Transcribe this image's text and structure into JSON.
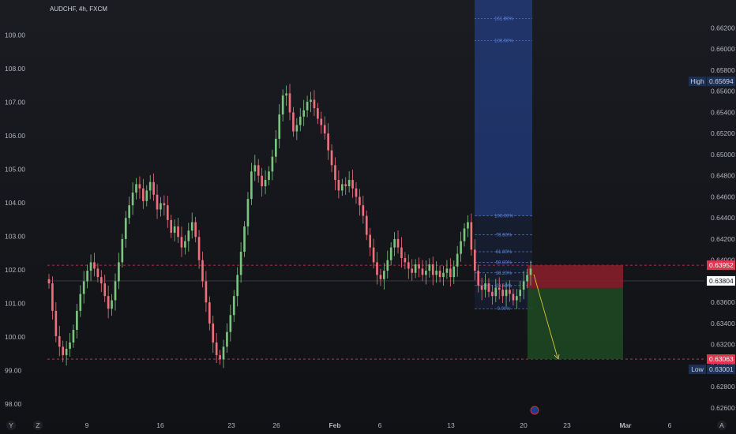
{
  "header": {
    "symbol": "AUDCHF, 4h, FXCM"
  },
  "colors": {
    "background": "#101114",
    "up_candle": "#7bc47f",
    "down_candle": "#ef6f7c",
    "fib_blue": "#2c5fe0",
    "resistance_line": "#e0344f",
    "stop_zone": "#8c1f2b",
    "target_zone": "#1f4a23",
    "arrow": "#d8c53a",
    "high_tag": "#1c2f55",
    "low_tag": "#1c2f55",
    "price_tag_red": "#e0344f"
  },
  "chart_data": {
    "type": "candlestick",
    "title": "AUDCHF, 4h, FXCM",
    "left_axis": {
      "ticks": [
        "109.00",
        "108.00",
        "107.00",
        "106.00",
        "105.00",
        "104.00",
        "103.00",
        "102.00",
        "101.00",
        "100.00",
        "99.00",
        "98.00"
      ],
      "ylim": [
        97.7,
        109.9
      ]
    },
    "right_axis": {
      "ticks": [
        "0.66200",
        "0.66000",
        "0.65800",
        "0.65600",
        "0.65400",
        "0.65200",
        "0.65000",
        "0.64800",
        "0.64600",
        "0.64400",
        "0.64200",
        "0.64000",
        "0.63800",
        "0.63600",
        "0.63400",
        "0.63200",
        "0.63000",
        "0.62800",
        "0.62600"
      ],
      "ylim": [
        0.6254,
        0.6642
      ]
    },
    "x_ticks": [
      "9",
      "16",
      "23",
      "26",
      "Feb",
      "6",
      "13",
      "20",
      "23",
      "Mar",
      "6"
    ],
    "bottom_left_labels": [
      "Y",
      "Z"
    ],
    "bottom_right_label": "A",
    "close_series": [
      0.6378,
      0.6352,
      0.6328,
      0.6318,
      0.631,
      0.6316,
      0.6322,
      0.6334,
      0.6352,
      0.6368,
      0.638,
      0.639,
      0.6398,
      0.6392,
      0.6384,
      0.6378,
      0.6366,
      0.6354,
      0.6362,
      0.638,
      0.6398,
      0.642,
      0.644,
      0.6452,
      0.6464,
      0.6472,
      0.6468,
      0.6456,
      0.6466,
      0.6474,
      0.6462,
      0.6448,
      0.6454,
      0.6452,
      0.6438,
      0.6426,
      0.6432,
      0.6422,
      0.6412,
      0.6418,
      0.6428,
      0.6436,
      0.6422,
      0.64,
      0.638,
      0.636,
      0.634,
      0.6322,
      0.631,
      0.6306,
      0.6318,
      0.6332,
      0.6348,
      0.6366,
      0.6386,
      0.6408,
      0.6432,
      0.6458,
      0.6484,
      0.649,
      0.648,
      0.647,
      0.6476,
      0.6484,
      0.6498,
      0.6515,
      0.6538,
      0.6556,
      0.6558,
      0.654,
      0.6522,
      0.6528,
      0.6536,
      0.6542,
      0.655,
      0.6552,
      0.6544,
      0.6534,
      0.6528,
      0.652,
      0.6504,
      0.649,
      0.6476,
      0.6466,
      0.6472,
      0.647,
      0.6476,
      0.6468,
      0.646,
      0.6452,
      0.6442,
      0.6424,
      0.6412,
      0.6398,
      0.6386,
      0.6382,
      0.639,
      0.64,
      0.6412,
      0.642,
      0.6412,
      0.6402,
      0.6398,
      0.6392,
      0.6388,
      0.6396,
      0.6392,
      0.6386,
      0.639,
      0.6396,
      0.6386,
      0.639,
      0.6384,
      0.6388,
      0.6392,
      0.6384,
      0.6394,
      0.6406,
      0.6418,
      0.643,
      0.6436,
      0.641,
      0.639,
      0.6376,
      0.6372,
      0.6378,
      0.637,
      0.6366,
      0.6374,
      0.6372,
      0.6366,
      0.6372,
      0.6368,
      0.6362,
      0.6366,
      0.6372,
      0.638,
      0.6386,
      0.6392
    ],
    "candle_x_range": [
      62,
      672
    ],
    "fib_retracement": {
      "levels": [
        {
          "label": "161.80%",
          "price": 0.6629
        },
        {
          "label": "100.00%",
          "price": 0.6608
        },
        {
          "label": "100.00%",
          "price": 0.6442
        },
        {
          "label": "78.60%",
          "price": 0.6424
        },
        {
          "label": "61.80%",
          "price": 0.6408
        },
        {
          "label": "50.00%",
          "price": 0.6398
        },
        {
          "label": "38.20%",
          "price": 0.6388
        },
        {
          "label": "23.60%",
          "price": 0.6376
        },
        {
          "label": "0.00%",
          "price": 0.6354
        }
      ],
      "top_label": "161.80%",
      "mid_label": "100.00%"
    },
    "resistance_price": 0.63952,
    "support_price": 0.63063,
    "last_price": 0.63804,
    "price_tags": {
      "high_label": "High",
      "high_value": "0.65694",
      "resistance_value": "0.63952",
      "last_value": "0.63804",
      "support_value": "0.63063",
      "low_label": "Low",
      "low_value": "0.63001"
    },
    "position": {
      "entry": 0.63804,
      "stop": 0.63952,
      "target": 0.63063
    }
  }
}
